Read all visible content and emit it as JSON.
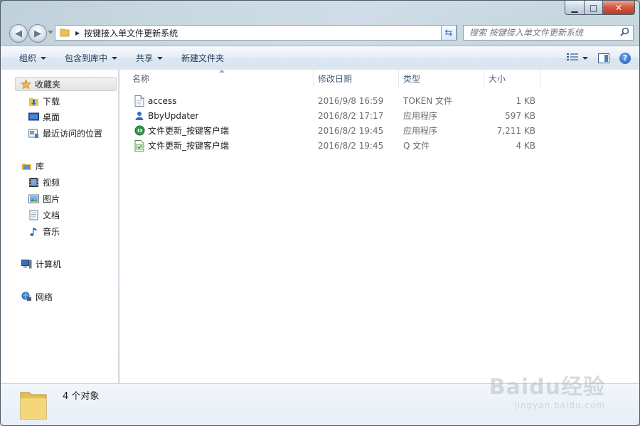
{
  "window": {
    "caption": {
      "minimize": "▁",
      "maximize": "□",
      "close": "✕"
    }
  },
  "nav": {
    "back_icon": "back-arrow-icon",
    "forward_icon": "forward-arrow-icon",
    "address": {
      "crumb": "按键接入单文件更新系统"
    },
    "search": {
      "placeholder": "搜索 按键接入单文件更新系统"
    }
  },
  "toolbar": {
    "organize": "组织",
    "include_library": "包含到库中",
    "share": "共享",
    "new_folder": "新建文件夹"
  },
  "sidebar": {
    "favorites": {
      "label": "收藏夹",
      "items": [
        {
          "label": "下载",
          "icon": "downloads-folder-icon"
        },
        {
          "label": "桌面",
          "icon": "desktop-icon"
        },
        {
          "label": "最近访问的位置",
          "icon": "recent-places-icon"
        }
      ]
    },
    "libraries": {
      "label": "库",
      "items": [
        {
          "label": "视频",
          "icon": "videos-icon"
        },
        {
          "label": "图片",
          "icon": "pictures-icon"
        },
        {
          "label": "文档",
          "icon": "documents-icon"
        },
        {
          "label": "音乐",
          "icon": "music-icon"
        }
      ]
    },
    "computer": {
      "label": "计算机"
    },
    "network": {
      "label": "网络"
    }
  },
  "columns": {
    "name": "名称",
    "date": "修改日期",
    "type": "类型",
    "size": "大小"
  },
  "files": [
    {
      "name": "access",
      "date": "2016/9/8 16:59",
      "type": "TOKEN 文件",
      "size": "1 KB",
      "icon": "token-file-icon"
    },
    {
      "name": "BbyUpdater",
      "date": "2016/8/2 17:17",
      "type": "应用程序",
      "size": "597 KB",
      "icon": "user-app-icon"
    },
    {
      "name": "文件更新_按键客户端",
      "date": "2016/8/2 19:45",
      "type": "应用程序",
      "size": "7,211 KB",
      "icon": "green-app-icon"
    },
    {
      "name": "文件更新_按键客户端",
      "date": "2016/8/2 19:45",
      "type": "Q 文件",
      "size": "4 KB",
      "icon": "q-file-icon"
    }
  ],
  "details": {
    "count": "4 个对象"
  },
  "watermark": {
    "main": "Baidu经验",
    "sub": "jingyan.baidu.com"
  },
  "colors": {
    "accent": "#1e395b",
    "selected_bg": "#e3e3e3",
    "muted_text": "#6d6d6d"
  }
}
